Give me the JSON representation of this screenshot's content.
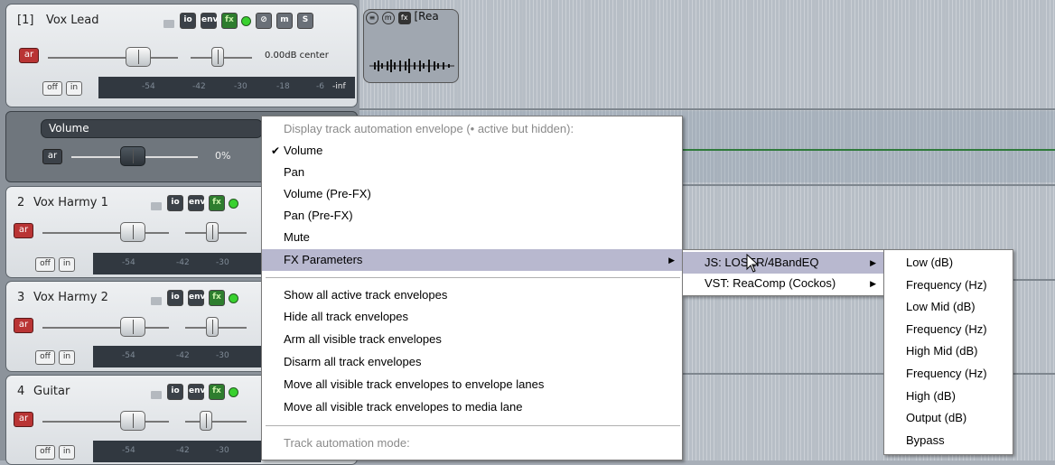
{
  "track1": {
    "num": "[1]",
    "name": "Vox Lead",
    "volume_text": "0.00dB center",
    "meter_labels": [
      "-54",
      "-42",
      "-30",
      "-18",
      "-6",
      "-inf"
    ]
  },
  "buttons": {
    "io": "io",
    "env": "env",
    "fx": "fx",
    "m": "m",
    "s": "S",
    "ar": "ar",
    "off": "off",
    "in": "in"
  },
  "envelope_lane": {
    "name": "Volume",
    "ar": "ar",
    "value": "0%"
  },
  "tracks": [
    {
      "num": "2",
      "name": "Vox Harmy 1",
      "meter_labels": [
        "-54",
        "-42",
        "-30"
      ]
    },
    {
      "num": "3",
      "name": "Vox Harmy 2",
      "meter_labels": [
        "-54",
        "-42",
        "-30"
      ]
    },
    {
      "num": "4",
      "name": "Guitar",
      "meter_labels": [
        "-54",
        "-42",
        "-30"
      ]
    }
  ],
  "media_item": {
    "title": "[Rea"
  },
  "context_menu": {
    "header": "Display track automation envelope (• active but hidden):",
    "items": [
      "Volume",
      "Pan",
      "Volume (Pre-FX)",
      "Pan (Pre-FX)",
      "Mute",
      "FX Parameters"
    ],
    "checked": "Volume",
    "actions": [
      "Show all active track envelopes",
      "Hide all track envelopes",
      "Arm all visible track envelopes",
      "Disarm all track envelopes",
      "Move all visible track envelopes to envelope lanes",
      "Move all visible track envelopes to media lane"
    ],
    "footer": "Track automation mode:"
  },
  "fx_submenu": {
    "items": [
      "JS: LOSER/4BandEQ",
      "VST: ReaComp (Cockos)"
    ]
  },
  "param_submenu": {
    "items": [
      "Low (dB)",
      "Frequency (Hz)",
      "Low Mid (dB)",
      "Frequency (Hz)",
      "High Mid (dB)",
      "Frequency (Hz)",
      "High (dB)",
      "Output (dB)",
      "Bypass"
    ]
  },
  "colors": {
    "accent_green": "#2e7d2e",
    "arm_red": "#b93434",
    "menu_highlight": "#b8b8cf"
  }
}
